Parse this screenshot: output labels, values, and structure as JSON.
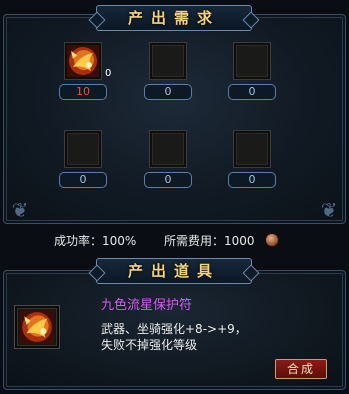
{
  "requirements": {
    "title": "产出需求",
    "slots": [
      {
        "qty": "10",
        "count": "0",
        "has_item": true
      },
      {
        "qty": "0",
        "count": "",
        "has_item": false
      },
      {
        "qty": "0",
        "count": "",
        "has_item": false
      },
      {
        "qty": "0",
        "count": "",
        "has_item": false
      },
      {
        "qty": "0",
        "count": "",
        "has_item": false
      },
      {
        "qty": "0",
        "count": "",
        "has_item": false
      }
    ]
  },
  "stats": {
    "success_label": "成功率：100%",
    "cost_label": "所需费用：1000",
    "currency_icon": "coin-icon"
  },
  "output": {
    "title": "产出道具",
    "item_name": "九色流星保护符",
    "desc_line1": "武器、坐骑强化+8->+9，",
    "desc_line2": "失败不掉强化等级",
    "synthesize_button": "合成"
  },
  "colors": {
    "banner_text": "#f2d27a",
    "item_name": "#d45cf0",
    "qty_highlight": "#ff4a2e",
    "button_bg": "#8a1c14"
  }
}
